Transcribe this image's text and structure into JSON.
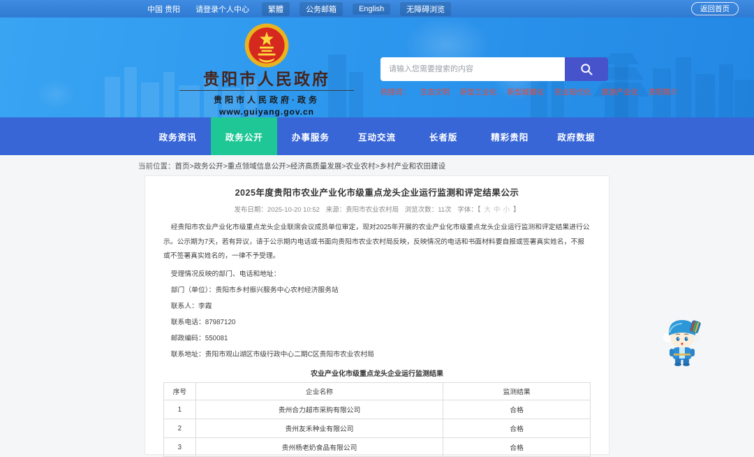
{
  "topbar": {
    "region_link": "中国 贵阳",
    "login_text": "请登录个人中心",
    "quick_links": [
      "繁體",
      "公务邮箱",
      "English",
      "无障碍浏览"
    ],
    "back_home": "返回首页"
  },
  "header": {
    "site_title": "贵阳市人民政府",
    "site_subtitle": "贵阳市人民政府·政务",
    "site_url": "www.guiyang.gov.cn",
    "search": {
      "placeholder": "请输入您需要搜索的内容"
    },
    "hot_search": {
      "label": "热搜词：",
      "words": [
        "生态文明",
        "新型工业化",
        "新型城镇化",
        "农业现代化",
        "旅游产业化",
        "贵阳简介"
      ]
    }
  },
  "nav": {
    "items": [
      {
        "label": "政务资讯",
        "active": false
      },
      {
        "label": "政务公开",
        "active": true
      },
      {
        "label": "办事服务",
        "active": false
      },
      {
        "label": "互动交流",
        "active": false
      },
      {
        "label": "长者版",
        "active": false
      },
      {
        "label": "精彩贵阳",
        "active": false
      },
      {
        "label": "政府数据",
        "active": false
      }
    ]
  },
  "breadcrumb": {
    "label": "当前位置：",
    "path": "首页>政务公开>重点领域信息公开>经济高质量发展>农业农村>乡村产业和农田建设"
  },
  "article": {
    "title": "2025年度贵阳市农业产业化市级重点龙头企业运行监测和评定结果公示",
    "meta": {
      "publish": "发布日期：2025-10-20 10:52",
      "source": "来源：贵阳市农业农村局",
      "views": "浏览次数：11次",
      "font_label": "字体：【",
      "font_sizes": [
        "大",
        "中",
        "小"
      ],
      "font_label_end": "】"
    },
    "paragraphs": [
      "经贵阳市农业产业化市级重点龙头企业联席会议成员单位审定，现对2025年开展的农业产业化市级重点龙头企业运行监测和评定结果进行公示。公示期为7天，若有异议，请于公示期内电话或书面向贵阳市农业农村局反映，反映情况的电话和书面材料要自报或签署真实姓名，不报或不签署真实姓名的，一律不予受理。",
      "受理情况反映的部门、电话和地址：",
      "部门（单位）：贵阳市乡村振兴服务中心农村经济服务站",
      "联系人：李霞",
      "联系电话：87987120",
      "邮政编码：550081",
      "联系地址：贵阳市观山湖区市级行政中心二期C区贵阳市农业农村局"
    ],
    "table": {
      "caption": "农业产业化市级重点龙头企业运行监测结果",
      "headers": [
        "序号",
        "企业名称",
        "监测结果"
      ],
      "rows": [
        {
          "no": "1",
          "name": "贵州合力超市采购有限公司",
          "result": "合格"
        },
        {
          "no": "2",
          "name": "贵州友禾种业有限公司",
          "result": "合格"
        },
        {
          "no": "3",
          "name": "贵州杨老奶食品有限公司",
          "result": "合格"
        }
      ]
    }
  },
  "colors": {
    "topbar_blue": "#3584dd",
    "banner_blue": "#2d97ee",
    "nav_blue": "#3866d7",
    "nav_active_green": "#1ec795",
    "search_button_indigo": "#4753cb",
    "hot_word_red": "#e8483a",
    "site_title_maroon": "#47231a"
  }
}
